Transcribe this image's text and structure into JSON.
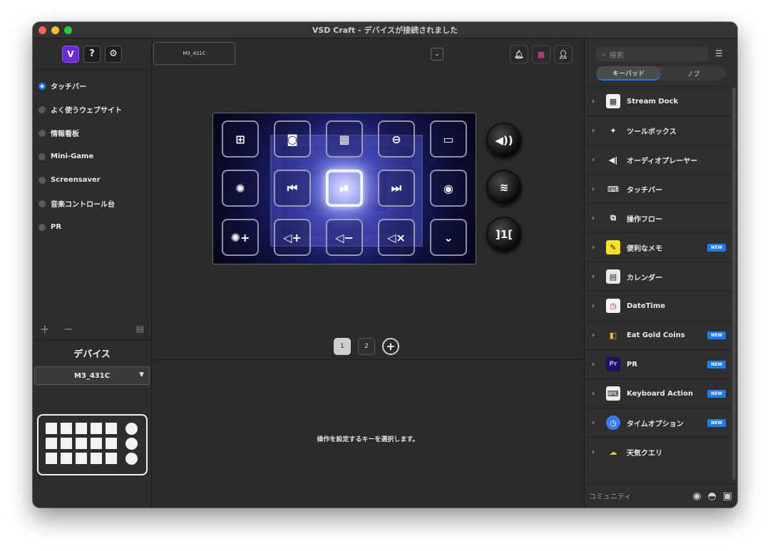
{
  "window": {
    "title": "VSD Craft - デバイスが接続されました"
  },
  "left": {
    "top_buttons": [
      {
        "name": "v",
        "glyph": "V"
      },
      {
        "name": "help",
        "glyph": "?"
      },
      {
        "name": "settings",
        "glyph": "⚙"
      }
    ],
    "profiles": [
      {
        "label": "タッチバー",
        "selected": true
      },
      {
        "label": "よく使うウェブサイト",
        "selected": false
      },
      {
        "label": "情報看板",
        "selected": false
      },
      {
        "label": "Mini-Game",
        "selected": false
      },
      {
        "label": "Screensaver",
        "selected": false
      },
      {
        "label": "音楽コントロール台",
        "selected": false
      },
      {
        "label": "PR",
        "selected": false
      }
    ],
    "tools": {
      "add": "+",
      "remove": "−"
    },
    "device_title": "デバイス",
    "device_select": "M3_431C"
  },
  "center": {
    "device_tab": "M3_431C",
    "keys": [
      "⊞",
      "◙",
      "▦",
      "⊖",
      "▭",
      "✺",
      "⏮",
      "⏯",
      "⏭",
      "◉",
      "✺+",
      "◁+",
      "◁−",
      "◁×",
      "⌄"
    ],
    "selected_key": 7,
    "knobs": [
      "◀))",
      "≋",
      "]1["
    ],
    "pages": [
      "1",
      "2"
    ],
    "add_page": "+",
    "hint": "操作を設定するキーを選択します。"
  },
  "right": {
    "search_placeholder": "検索",
    "tabs": [
      "キーパッド",
      "ノブ"
    ],
    "plugins": [
      {
        "label": "Stream Dock",
        "badge": "",
        "icon": "▦",
        "bg": "#f2f2f2",
        "fg": "#222"
      },
      {
        "label": "ツールボックス",
        "badge": "",
        "icon": "✦",
        "bg": "#2f2f2f",
        "fg": "#fff"
      },
      {
        "label": "オーディオプレーヤー",
        "badge": "",
        "icon": "◀|",
        "bg": "#2f2f2f",
        "fg": "#fff"
      },
      {
        "label": "タッチバー",
        "badge": "",
        "icon": "⌨",
        "bg": "#2f2f2f",
        "fg": "#fff"
      },
      {
        "label": "操作フロー",
        "badge": "",
        "icon": "⧉",
        "bg": "#2f2f2f",
        "fg": "#fff"
      },
      {
        "label": "便利なメモ",
        "badge": "NEW",
        "icon": "✎",
        "bg": "#f6e02c",
        "fg": "#222"
      },
      {
        "label": "カレンダー",
        "badge": "",
        "icon": "▤",
        "bg": "#e8e8e8",
        "fg": "#222"
      },
      {
        "label": "DateTime",
        "badge": "",
        "icon": "◷",
        "bg": "#f4f4f4",
        "fg": "#c22"
      },
      {
        "label": "Eat Gold Coins",
        "badge": "NEW",
        "icon": "◧",
        "bg": "#2f2f2f",
        "fg": "#f2b81e"
      },
      {
        "label": "PR",
        "badge": "NEW",
        "icon": "Pr",
        "bg": "#1a1460",
        "fg": "#b9a8ff"
      },
      {
        "label": "Keyboard Action",
        "badge": "NEW",
        "icon": "⌨",
        "bg": "#eeeeee",
        "fg": "#222"
      },
      {
        "label": "タイムオプション",
        "badge": "NEW",
        "icon": "◷",
        "bg": "#3a7bea",
        "fg": "#fff"
      },
      {
        "label": "天気クエリ",
        "badge": "",
        "icon": "☁",
        "bg": "#2f2f2f",
        "fg": "#f2c24a"
      }
    ],
    "community": "コミュニティ",
    "community_icons": [
      "reddit-icon",
      "discord-icon",
      "chat-icon"
    ]
  }
}
